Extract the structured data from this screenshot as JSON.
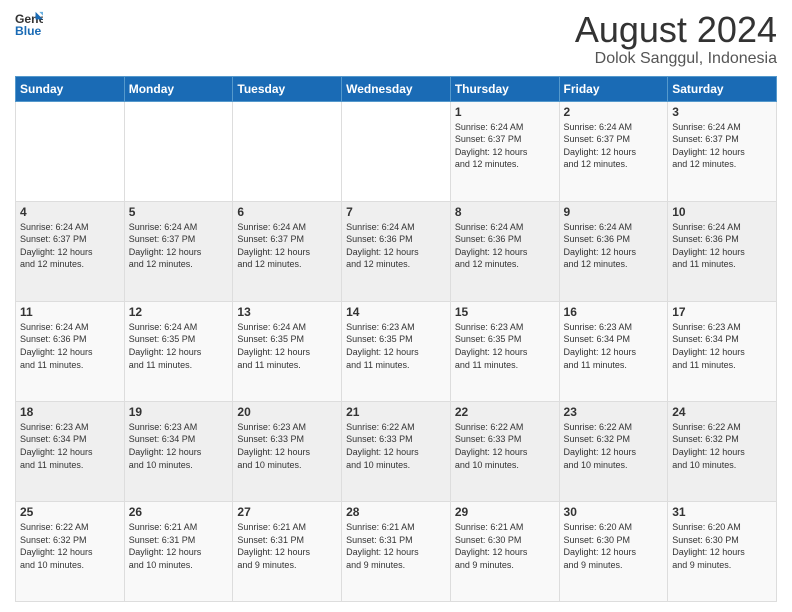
{
  "header": {
    "logo_line1": "General",
    "logo_line2": "Blue",
    "main_title": "August 2024",
    "subtitle": "Dolok Sanggul, Indonesia"
  },
  "weekdays": [
    "Sunday",
    "Monday",
    "Tuesday",
    "Wednesday",
    "Thursday",
    "Friday",
    "Saturday"
  ],
  "weeks": [
    [
      {
        "day": "",
        "info": ""
      },
      {
        "day": "",
        "info": ""
      },
      {
        "day": "",
        "info": ""
      },
      {
        "day": "",
        "info": ""
      },
      {
        "day": "1",
        "info": "Sunrise: 6:24 AM\nSunset: 6:37 PM\nDaylight: 12 hours\nand 12 minutes."
      },
      {
        "day": "2",
        "info": "Sunrise: 6:24 AM\nSunset: 6:37 PM\nDaylight: 12 hours\nand 12 minutes."
      },
      {
        "day": "3",
        "info": "Sunrise: 6:24 AM\nSunset: 6:37 PM\nDaylight: 12 hours\nand 12 minutes."
      }
    ],
    [
      {
        "day": "4",
        "info": "Sunrise: 6:24 AM\nSunset: 6:37 PM\nDaylight: 12 hours\nand 12 minutes."
      },
      {
        "day": "5",
        "info": "Sunrise: 6:24 AM\nSunset: 6:37 PM\nDaylight: 12 hours\nand 12 minutes."
      },
      {
        "day": "6",
        "info": "Sunrise: 6:24 AM\nSunset: 6:37 PM\nDaylight: 12 hours\nand 12 minutes."
      },
      {
        "day": "7",
        "info": "Sunrise: 6:24 AM\nSunset: 6:36 PM\nDaylight: 12 hours\nand 12 minutes."
      },
      {
        "day": "8",
        "info": "Sunrise: 6:24 AM\nSunset: 6:36 PM\nDaylight: 12 hours\nand 12 minutes."
      },
      {
        "day": "9",
        "info": "Sunrise: 6:24 AM\nSunset: 6:36 PM\nDaylight: 12 hours\nand 12 minutes."
      },
      {
        "day": "10",
        "info": "Sunrise: 6:24 AM\nSunset: 6:36 PM\nDaylight: 12 hours\nand 11 minutes."
      }
    ],
    [
      {
        "day": "11",
        "info": "Sunrise: 6:24 AM\nSunset: 6:36 PM\nDaylight: 12 hours\nand 11 minutes."
      },
      {
        "day": "12",
        "info": "Sunrise: 6:24 AM\nSunset: 6:35 PM\nDaylight: 12 hours\nand 11 minutes."
      },
      {
        "day": "13",
        "info": "Sunrise: 6:24 AM\nSunset: 6:35 PM\nDaylight: 12 hours\nand 11 minutes."
      },
      {
        "day": "14",
        "info": "Sunrise: 6:23 AM\nSunset: 6:35 PM\nDaylight: 12 hours\nand 11 minutes."
      },
      {
        "day": "15",
        "info": "Sunrise: 6:23 AM\nSunset: 6:35 PM\nDaylight: 12 hours\nand 11 minutes."
      },
      {
        "day": "16",
        "info": "Sunrise: 6:23 AM\nSunset: 6:34 PM\nDaylight: 12 hours\nand 11 minutes."
      },
      {
        "day": "17",
        "info": "Sunrise: 6:23 AM\nSunset: 6:34 PM\nDaylight: 12 hours\nand 11 minutes."
      }
    ],
    [
      {
        "day": "18",
        "info": "Sunrise: 6:23 AM\nSunset: 6:34 PM\nDaylight: 12 hours\nand 11 minutes."
      },
      {
        "day": "19",
        "info": "Sunrise: 6:23 AM\nSunset: 6:34 PM\nDaylight: 12 hours\nand 10 minutes."
      },
      {
        "day": "20",
        "info": "Sunrise: 6:23 AM\nSunset: 6:33 PM\nDaylight: 12 hours\nand 10 minutes."
      },
      {
        "day": "21",
        "info": "Sunrise: 6:22 AM\nSunset: 6:33 PM\nDaylight: 12 hours\nand 10 minutes."
      },
      {
        "day": "22",
        "info": "Sunrise: 6:22 AM\nSunset: 6:33 PM\nDaylight: 12 hours\nand 10 minutes."
      },
      {
        "day": "23",
        "info": "Sunrise: 6:22 AM\nSunset: 6:32 PM\nDaylight: 12 hours\nand 10 minutes."
      },
      {
        "day": "24",
        "info": "Sunrise: 6:22 AM\nSunset: 6:32 PM\nDaylight: 12 hours\nand 10 minutes."
      }
    ],
    [
      {
        "day": "25",
        "info": "Sunrise: 6:22 AM\nSunset: 6:32 PM\nDaylight: 12 hours\nand 10 minutes."
      },
      {
        "day": "26",
        "info": "Sunrise: 6:21 AM\nSunset: 6:31 PM\nDaylight: 12 hours\nand 10 minutes."
      },
      {
        "day": "27",
        "info": "Sunrise: 6:21 AM\nSunset: 6:31 PM\nDaylight: 12 hours\nand 9 minutes."
      },
      {
        "day": "28",
        "info": "Sunrise: 6:21 AM\nSunset: 6:31 PM\nDaylight: 12 hours\nand 9 minutes."
      },
      {
        "day": "29",
        "info": "Sunrise: 6:21 AM\nSunset: 6:30 PM\nDaylight: 12 hours\nand 9 minutes."
      },
      {
        "day": "30",
        "info": "Sunrise: 6:20 AM\nSunset: 6:30 PM\nDaylight: 12 hours\nand 9 minutes."
      },
      {
        "day": "31",
        "info": "Sunrise: 6:20 AM\nSunset: 6:30 PM\nDaylight: 12 hours\nand 9 minutes."
      }
    ]
  ]
}
